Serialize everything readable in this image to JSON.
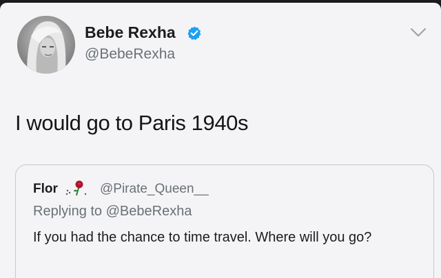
{
  "tweet": {
    "author": {
      "name": "Bebe Rexha",
      "handle": "@BebeRexha",
      "verified": true,
      "verified_color": "#1da1f2"
    },
    "text": "I would go to Paris 1940s",
    "menu_icon": "chevron-down-icon"
  },
  "quoted_tweet": {
    "author": {
      "name": "Flor",
      "emoji_icon": "rose-icon",
      "handle": "@Pirate_Queen__"
    },
    "replying_prefix": "Replying to",
    "replying_to": "@BebeRexha",
    "text": "If you had the chance to time travel. Where will you go?"
  }
}
